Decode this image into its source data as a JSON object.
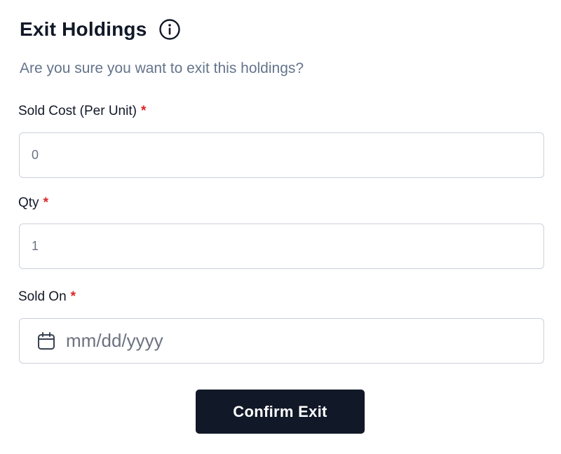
{
  "dialog": {
    "title": "Exit Holdings",
    "subtitle": "Are you sure you want to exit this holdings?",
    "info_icon": "info-circle-icon"
  },
  "fields": {
    "sold_cost": {
      "label": "Sold Cost (Per Unit)",
      "required_mark": "*",
      "value": "0"
    },
    "qty": {
      "label": "Qty",
      "required_mark": "*",
      "value": "1"
    },
    "sold_on": {
      "label": "Sold On",
      "required_mark": "*",
      "placeholder": "mm/dd/yyyy",
      "icon": "calendar-icon"
    }
  },
  "actions": {
    "confirm_label": "Confirm Exit"
  },
  "colors": {
    "primary": "#111827",
    "required": "#dc2626",
    "muted": "#64748b",
    "border": "#cbd1d9"
  }
}
